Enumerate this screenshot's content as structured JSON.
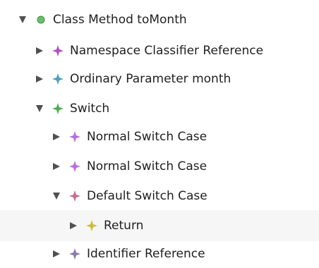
{
  "tree": {
    "nodes": [
      {
        "label": "Class Method toMonth",
        "icon": "green-dot-icon",
        "state": "expanded",
        "color": "#5cb85c"
      },
      {
        "label": "Namespace Classifier Reference",
        "icon": "purple-star-icon",
        "state": "collapsed",
        "color": "#a44fb0"
      },
      {
        "label": "Ordinary Parameter month",
        "icon": "teal-star-icon",
        "state": "collapsed",
        "color": "#4f9fb0"
      },
      {
        "label": "Switch",
        "icon": "green-star-icon",
        "state": "expanded",
        "color": "#4caf50"
      },
      {
        "label": "Normal Switch Case",
        "icon": "violet-star-icon",
        "state": "collapsed",
        "color": "#b06ad0"
      },
      {
        "label": "Normal Switch Case",
        "icon": "violet-star-icon",
        "state": "collapsed",
        "color": "#b06ad0"
      },
      {
        "label": "Default Switch Case",
        "icon": "rose-star-icon",
        "state": "expanded",
        "color": "#b0688a"
      },
      {
        "label": "Return",
        "icon": "yellow-star-icon",
        "state": "collapsed",
        "color": "#c8bb3c"
      },
      {
        "label": "Identifier Reference",
        "icon": "purple-gray-star-icon",
        "state": "collapsed",
        "color": "#8a7aa0"
      }
    ]
  }
}
